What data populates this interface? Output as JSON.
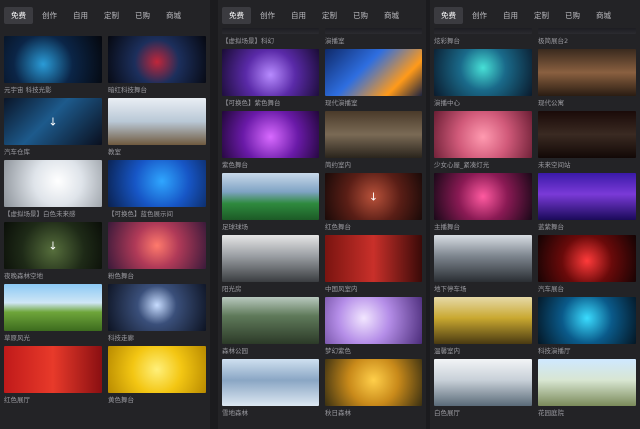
{
  "panels": [
    {
      "tabs": [
        "免费",
        "创作",
        "自用",
        "定制",
        "已购",
        "商城"
      ],
      "active_tab": 0,
      "items": [
        {
          "caption": "元宇宙 科技光影",
          "bg": "radial-gradient(circle at 40% 60%,#2a9bd7 0%,#0b2547 45%,#05070d 100%)"
        },
        {
          "caption": "暗红科技舞台",
          "bg": "radial-gradient(circle at 50% 55%,#c0263a 0%,#1c2f5c 40%,#060810 100%)"
        },
        {
          "caption": "汽车仓库",
          "bg": "linear-gradient(135deg,#0a1528 0%,#1d5a8c 45%,#0a0f1e 100%)",
          "download": true
        },
        {
          "caption": "教室",
          "bg": "linear-gradient(180deg,#e9eef4 0%,#b9c8d6 50%,#6f5a3f 100%)"
        },
        {
          "caption": "【虚拟场景】白色未来感",
          "bg": "radial-gradient(circle at 55% 45%,#ffffff 0%,#dfe4ea 40%,#8c9299 100%)"
        },
        {
          "caption": "【可换色】蓝色展示间",
          "bg": "radial-gradient(circle at 55% 45%,#2fa6ff 0%,#1756c6 45%,#0a214f 100%)"
        },
        {
          "caption": "夜晚森林空地",
          "bg": "radial-gradient(circle at 50% 60%,#566e3c 0%,#1e2a17 55%,#0a0e08 100%)",
          "download": true
        },
        {
          "caption": "粉色舞台",
          "bg": "radial-gradient(circle at 50% 50%,#ff7a6c 0%,#b03a58 40%,#3a1a3a 100%)"
        },
        {
          "caption": "草原风光",
          "bg": "linear-gradient(180deg,#8cc9f5 0%,#cfe6f5 40%,#6ea53a 60%,#3c6b1e 100%)"
        },
        {
          "caption": "科技走廊",
          "bg": "radial-gradient(circle at 50% 45%,#c7dcff 0%,#3a4f7a 35%,#0d1322 100%)"
        },
        {
          "caption": "红色展厅",
          "bg": "linear-gradient(90deg,#c01a1a 0%,#e83a2a 50%,#8a0f12 100%)"
        },
        {
          "caption": "黄色舞台",
          "bg": "radial-gradient(circle at 50% 50%,#fff07a 0%,#f3c613 45%,#b88a00 100%)"
        }
      ]
    },
    {
      "tabs": [
        "免费",
        "创作",
        "自用",
        "定制",
        "已购",
        "商城"
      ],
      "active_tab": 0,
      "items": [
        {
          "caption": "【虚拟场景】科幻",
          "bg": "linear-gradient(180deg,#1d1d22 0%,#2b2b30 100%)",
          "short": true
        },
        {
          "caption": "演播室",
          "bg": "linear-gradient(180deg,#1d1d22 0%,#2b2b30 100%)",
          "short": true
        },
        {
          "caption": "【可换色】紫色舞台",
          "bg": "radial-gradient(circle at 50% 55%,#b78bff 0%,#5a2aa8 45%,#1a0c35 100%)"
        },
        {
          "caption": "现代演播室",
          "bg": "linear-gradient(135deg,#0f2a6a 0%,#2e6ee0 40%,#ff9a1a 75%,#1c2340 100%)"
        },
        {
          "caption": "紫色舞台",
          "bg": "radial-gradient(circle at 50% 55%,#d86aff 0%,#6a1aa8 50%,#22073a 100%)"
        },
        {
          "caption": "简约室内",
          "bg": "linear-gradient(180deg,#4a3a2a 0%,#7a6a55 50%,#2a241c 100%)"
        },
        {
          "caption": "足球球场",
          "bg": "linear-gradient(180deg,#c9d9ea 0%,#7fa3c4 40%,#2e8a3e 65%,#1c5a26 100%)"
        },
        {
          "caption": "红色舞台",
          "bg": "radial-gradient(circle at 50% 50%,#b8513a 0%,#5a1e16 50%,#1a0a08 100%)",
          "download": true
        },
        {
          "caption": "阳光房",
          "bg": "linear-gradient(180deg,#e6e6e6 0%,#9a9ea3 45%,#3a3d40 100%)"
        },
        {
          "caption": "中国风室内",
          "bg": "linear-gradient(90deg,#7a1410 0%,#c9302a 50%,#3a0a08 100%)"
        },
        {
          "caption": "森林公园",
          "bg": "linear-gradient(180deg,#b9c9bf 0%,#5f7a5a 40%,#2c3a28 100%)"
        },
        {
          "caption": "梦幻紫色",
          "bg": "radial-gradient(circle at 40% 45%,#f2e6ff 0%,#b58ee8 40%,#4b2c7a 100%)"
        },
        {
          "caption": "雪地森林",
          "bg": "linear-gradient(180deg,#cfe0f0 0%,#8aa6c4 45%,#dde8f2 100%)"
        },
        {
          "caption": "秋日森林",
          "bg": "radial-gradient(circle at 50% 45%,#ffcf4a 0%,#c98a1a 45%,#3a3012 100%)"
        }
      ]
    },
    {
      "tabs": [
        "免费",
        "创作",
        "自用",
        "定制",
        "已购",
        "商城"
      ],
      "active_tab": 0,
      "items": [
        {
          "caption": "炫彩舞台",
          "bg": "linear-gradient(180deg,#1d1d22 0%,#2b2b30 100%)",
          "short": true
        },
        {
          "caption": "极简展台2",
          "bg": "linear-gradient(180deg,#1d1d22 0%,#2b2b30 100%)",
          "short": true
        },
        {
          "caption": "演播中心",
          "bg": "radial-gradient(circle at 50% 40%,#47e0d6 0%,#1a6a8a 40%,#0a1a2c 100%)"
        },
        {
          "caption": "现代公寓",
          "bg": "linear-gradient(180deg,#3a2a1e 0%,#8a6040 50%,#2a1c12 100%)"
        },
        {
          "caption": "少女心屋_紧凑灯光",
          "bg": "radial-gradient(circle at 50% 55%,#ff9ab0 0%,#d15a7a 45%,#6a1e34 100%)"
        },
        {
          "caption": "未来空间站",
          "bg": "linear-gradient(180deg,#1a0a08 0%,#3a2a22 50%,#120806 100%)"
        },
        {
          "caption": "主播舞台",
          "bg": "radial-gradient(circle at 50% 50%,#ff5aa0 0%,#8a1a54 45%,#1a0818 100%)"
        },
        {
          "caption": "蓝紫舞台",
          "bg": "linear-gradient(180deg,#3a1aa8 0%,#7a3ad8 45%,#1a0a5a 100%)"
        },
        {
          "caption": "地下停车场",
          "bg": "linear-gradient(180deg,#d8dde3 0%,#7d858e 45%,#2a2e33 100%)"
        },
        {
          "caption": "汽车展台",
          "bg": "radial-gradient(circle at 50% 55%,#ff3a3a 0%,#6a0a0a 45%,#120303 100%)"
        },
        {
          "caption": "温馨室内",
          "bg": "linear-gradient(180deg,#e6d9a8 0%,#c9a830 45%,#4a3a12 100%)"
        },
        {
          "caption": "科技演播厅",
          "bg": "radial-gradient(circle at 50% 45%,#3adcff 0%,#0a5a8a 45%,#041624 100%)"
        },
        {
          "caption": "白色展厅",
          "bg": "linear-gradient(180deg,#f2f4f6 0%,#c8d0d8 45%,#5a6a78 100%)"
        },
        {
          "caption": "花园庭院",
          "bg": "linear-gradient(180deg,#cfe8ff 0%,#d8e6d2 45%,#7a8a5a 100%)"
        }
      ]
    }
  ]
}
